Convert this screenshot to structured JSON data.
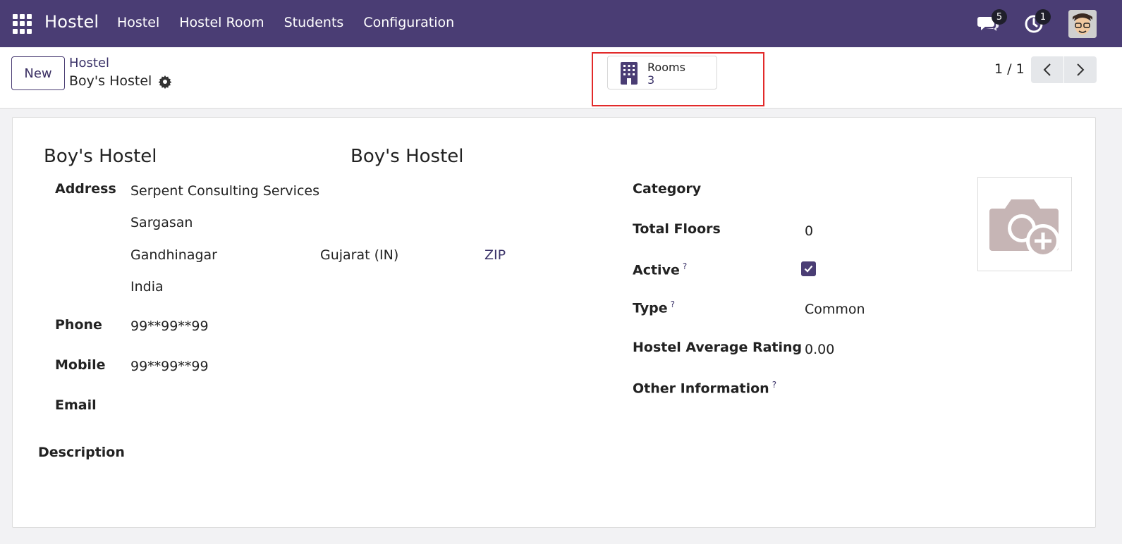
{
  "navbar": {
    "brand": "Hostel",
    "menu": [
      "Hostel",
      "Hostel Room",
      "Students",
      "Configuration"
    ],
    "messages_count": "5",
    "activities_count": "1",
    "bg_color": "#4a3d74"
  },
  "control_panel": {
    "new_label": "New",
    "breadcrumb_parent": "Hostel",
    "breadcrumb_current": "Boy's Hostel",
    "stat_button": {
      "label": "Rooms",
      "value": "3",
      "icon": "building-icon"
    },
    "pager": "1 / 1"
  },
  "form": {
    "name": "Boy's Hostel",
    "display_name": "Boy's Hostel",
    "address_label": "Address",
    "address": {
      "street": "Serpent Consulting Services",
      "street2": "Sargasan",
      "city": "Gandhinagar",
      "state": "Gujarat (IN)",
      "zip_placeholder": "ZIP",
      "country": "India"
    },
    "phone_label": "Phone",
    "phone": "99**99**99",
    "mobile_label": "Mobile",
    "mobile": "99**99**99",
    "email_label": "Email",
    "email": "",
    "description_label": "Description",
    "category_label": "Category",
    "category": "",
    "total_floors_label": "Total Floors",
    "total_floors": "0",
    "active_label": "Active",
    "active": true,
    "type_label": "Type",
    "type": "Common",
    "rating_label": "Hostel Average Rating",
    "rating": "0.00",
    "other_info_label": "Other Information",
    "help_mark": "?"
  }
}
